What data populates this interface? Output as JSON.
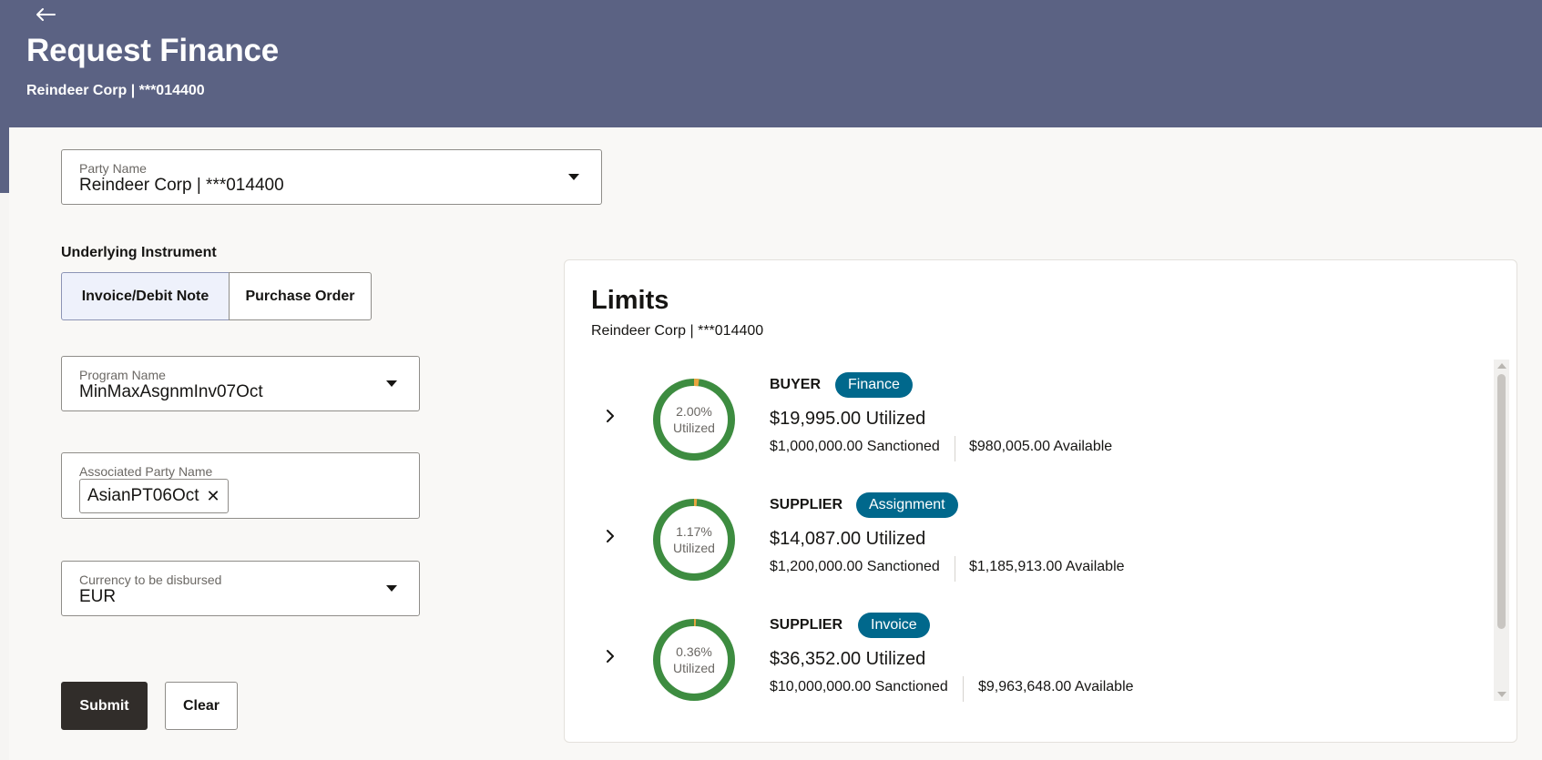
{
  "header": {
    "title": "Request Finance",
    "subtitle": "Reindeer Corp | ***014400",
    "back_icon": "arrow-left-icon"
  },
  "form": {
    "party_name": {
      "label": "Party Name",
      "value": "Reindeer Corp | ***014400"
    },
    "underlying_instrument": {
      "label": "Underlying Instrument",
      "options": [
        "Invoice/Debit Note",
        "Purchase Order"
      ],
      "selected": "Invoice/Debit Note"
    },
    "program_name": {
      "label": "Program Name",
      "value": "MinMaxAsgnmInv07Oct"
    },
    "associated_party": {
      "label": "Associated Party Name",
      "chip": "AsianPT06Oct",
      "remove_glyph": "✕"
    },
    "currency": {
      "label": "Currency to be disbursed",
      "value": "EUR"
    },
    "submit_label": "Submit",
    "clear_label": "Clear"
  },
  "limits": {
    "title": "Limits",
    "subtitle": "Reindeer Corp | ***014400",
    "items": [
      {
        "role": "BUYER",
        "badge": "Finance",
        "percent_text": "2.00%",
        "percent_value": 2.0,
        "utilized_caption": "Utilized",
        "utilized": "$19,995.00 Utilized",
        "sanctioned": "$1,000,000.00 Sanctioned",
        "available": "$980,005.00 Available"
      },
      {
        "role": "SUPPLIER",
        "badge": "Assignment",
        "percent_text": "1.17%",
        "percent_value": 1.17,
        "utilized_caption": "Utilized",
        "utilized": "$14,087.00 Utilized",
        "sanctioned": "$1,200,000.00 Sanctioned",
        "available": "$1,185,913.00 Available"
      },
      {
        "role": "SUPPLIER",
        "badge": "Invoice",
        "percent_text": "0.36%",
        "percent_value": 0.36,
        "utilized_caption": "Utilized",
        "utilized": "$36,352.00 Utilized",
        "sanctioned": "$10,000,000.00 Sanctioned",
        "available": "$9,963,648.00 Available"
      }
    ]
  },
  "colors": {
    "header_bg": "#5b6283",
    "badge_bg": "#00688c",
    "donut_available": "#3d8c40",
    "donut_utilized": "#e9a53f",
    "primary_button": "#312d2a"
  }
}
